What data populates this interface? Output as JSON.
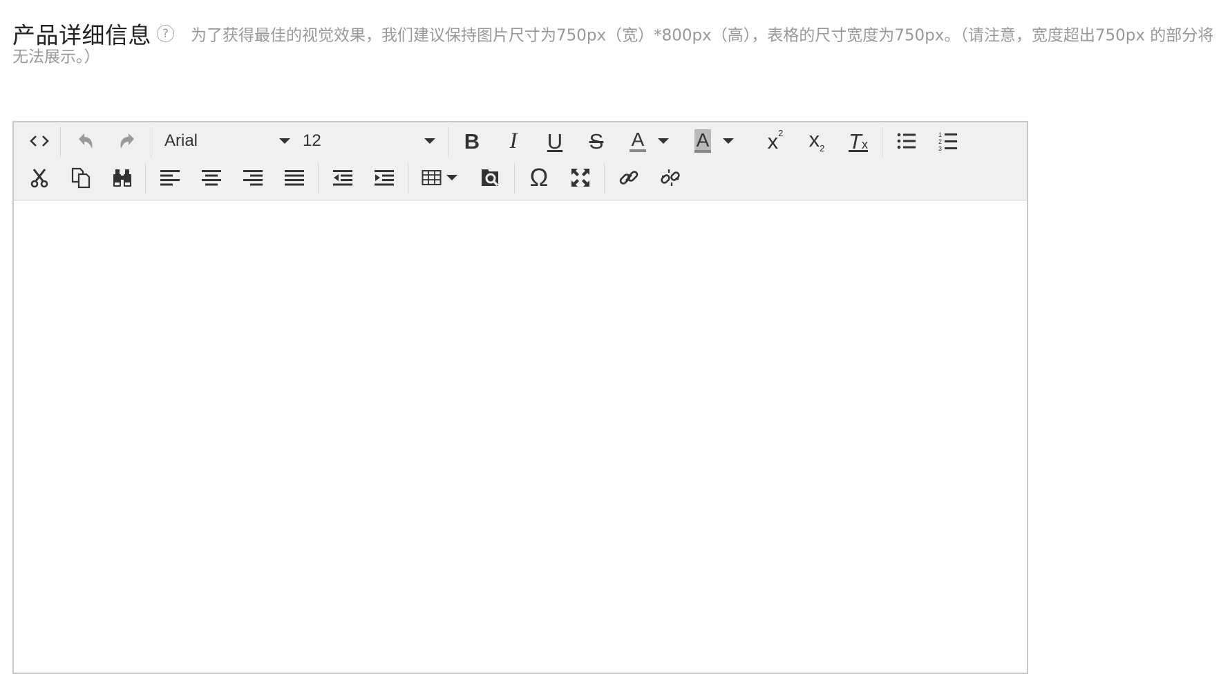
{
  "section": {
    "title": "产品详细信息",
    "help_icon": "?",
    "hint": "为了获得最佳的视觉效果，我们建议保持图片尺寸为750px（宽）*800px（高），表格的尺寸宽度为750px。（请注意，宽度超出750px 的部分将无法展示。）"
  },
  "toolbar": {
    "font_family": "Arial",
    "font_size": "12",
    "icons": {
      "source": "code-icon",
      "undo": "undo-icon",
      "redo": "redo-icon",
      "bold": "B",
      "italic": "I",
      "underline": "U",
      "strike": "S",
      "text_color": "A",
      "bg_color": "A",
      "superscript": "x",
      "subscript": "x",
      "clear_format": "T",
      "omega": "Ω"
    }
  },
  "editor": {
    "content": ""
  }
}
